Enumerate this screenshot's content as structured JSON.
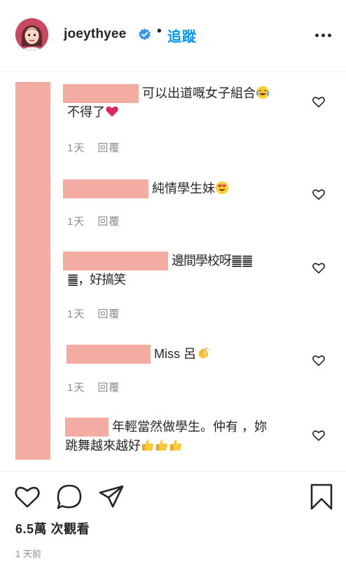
{
  "header": {
    "username": "joeythyee",
    "separator": "•",
    "follow_label": "追蹤"
  },
  "comments": [
    {
      "text_line1": "可以出道嘅女子組合",
      "text_line2": "不得了",
      "emoji": [
        "face-with-tears-of-joy",
        "red-heart"
      ],
      "time": "1天",
      "reply": "回覆"
    },
    {
      "text_line1": "純情學生妹",
      "emoji": [
        "smiling-face-with-heart-eyes"
      ],
      "time": "1天",
      "reply": "回覆"
    },
    {
      "text_line1": "邊間學校呀䷀䷀",
      "text_line2": "䷀，好搞笑",
      "time": "1天",
      "reply": "回覆"
    },
    {
      "text_line1": "Miss 呂",
      "emoji": [
        "clapping-hands"
      ],
      "time": "1天",
      "reply": "回覆"
    },
    {
      "text_line1": "年輕當然做學生。仲有 ，妳",
      "text_line2": "跳舞越來越好",
      "emoji": [
        "thumbs-up",
        "thumbs-up",
        "thumbs-up"
      ]
    }
  ],
  "footer": {
    "views": "6.5萬 次觀看",
    "timestamp": "1 天前"
  },
  "colors": {
    "redaction": "#f3aca1",
    "follow": "#0095f6",
    "verified": "#3897f0",
    "muted": "#8e8e8e"
  },
  "icons": [
    "verified-badge-icon",
    "more-options-icon",
    "heart-icon",
    "comment-icon",
    "share-icon",
    "bookmark-icon"
  ]
}
